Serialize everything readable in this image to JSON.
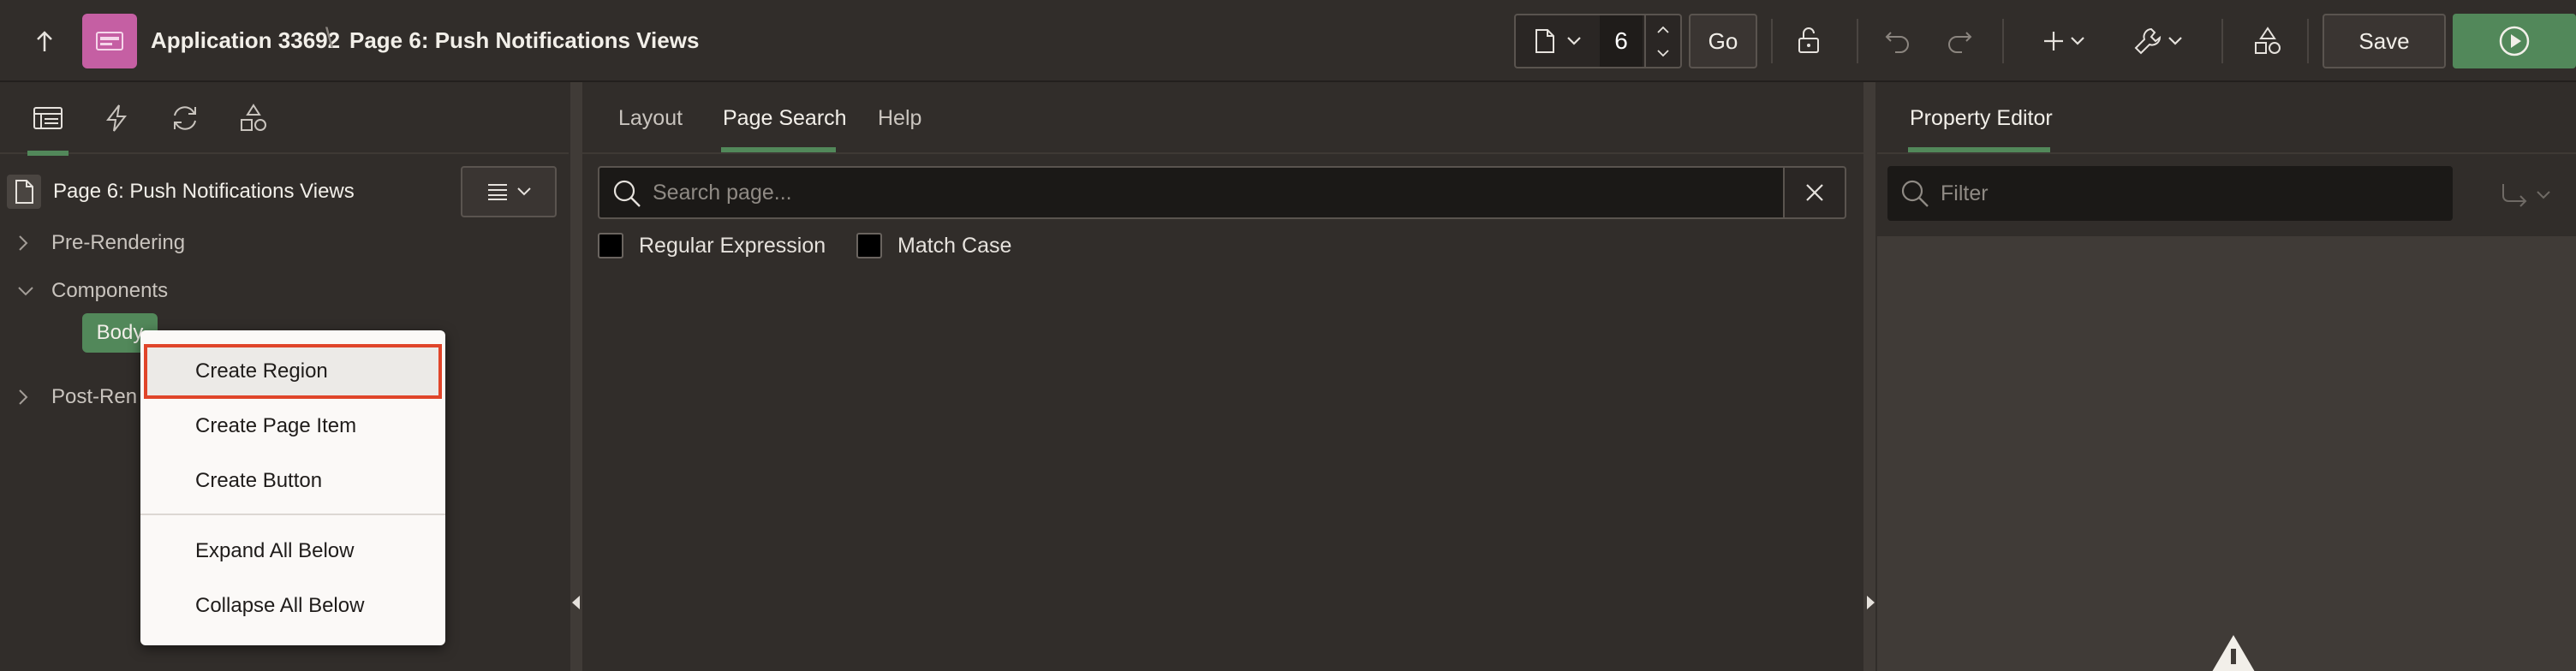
{
  "header": {
    "up_icon": "arrow-up-icon",
    "app_title": "Application 33692",
    "separator": "\\",
    "page_title": "Page 6: Push Notifications Views",
    "page_number": "6",
    "go_label": "Go",
    "save_label": "Save",
    "icons": [
      "page-icon",
      "chevron-down-icon",
      "spinner-up-icon",
      "spinner-down-icon",
      "lock-icon",
      "undo-icon",
      "redo-icon",
      "plus-icon",
      "wrench-icon",
      "shapes-icon",
      "run-icon"
    ]
  },
  "left_panel": {
    "tabs": [
      {
        "icon": "rendering-tree-icon",
        "active": true
      },
      {
        "icon": "dynamic-actions-icon",
        "active": false
      },
      {
        "icon": "processing-icon",
        "active": false
      },
      {
        "icon": "shared-components-icon",
        "active": false
      }
    ],
    "tree": {
      "root_label": "Page 6: Push Notifications Views",
      "pre_rendering": "Pre-Rendering",
      "components": "Components",
      "body": "Body",
      "post_rendering": "Post-Ren"
    }
  },
  "center_panel": {
    "tabs": [
      {
        "label": "Layout",
        "active": false
      },
      {
        "label": "Page Search",
        "active": true
      },
      {
        "label": "Help",
        "active": false
      }
    ],
    "search_placeholder": "Search page...",
    "option_regex": "Regular Expression",
    "option_match_case": "Match Case"
  },
  "right_panel": {
    "tab_label": "Property Editor",
    "filter_placeholder": "Filter"
  },
  "context_menu": {
    "items": [
      "Create Region",
      "Create Page Item",
      "Create Button",
      "Expand All Below",
      "Collapse All Below"
    ],
    "highlighted": "Create Region"
  },
  "colors": {
    "accent_green": "#52885a",
    "app_logo": "#c55fa3",
    "highlight_border": "#e0452a",
    "background": "#312d2a"
  }
}
